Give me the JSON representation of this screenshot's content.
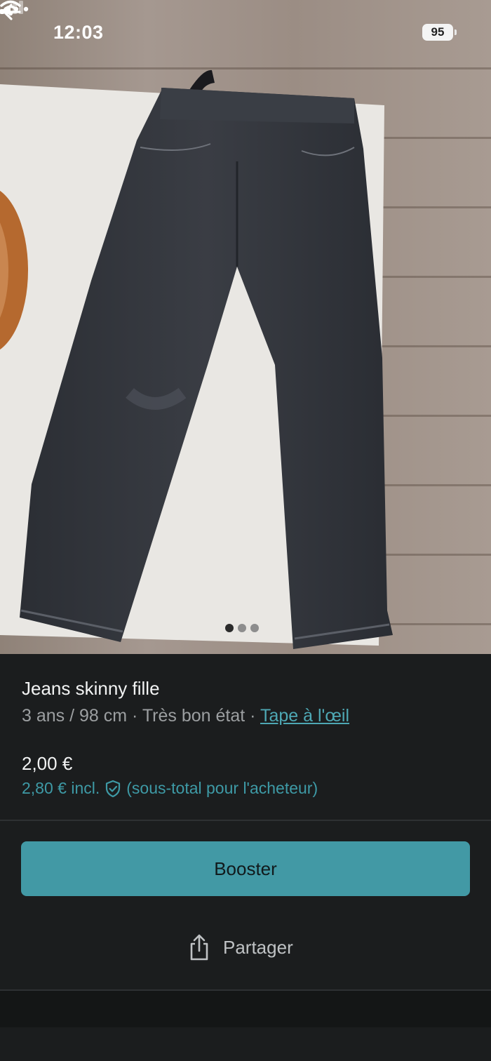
{
  "status_bar": {
    "time": "12:03",
    "battery": "95"
  },
  "photo": {
    "pager_total": 3,
    "pager_active": 0
  },
  "item": {
    "title": "Jeans skinny fille",
    "size": "3 ans / 98 cm",
    "separator": " · ",
    "condition": "Très bon état",
    "brand": "Tape à l'œil",
    "price": "2,00 €",
    "price_incl": "2,80 € incl.",
    "price_note": "(sous-total pour l'acheteur)"
  },
  "actions": {
    "booster_label": "Booster",
    "share_label": "Partager"
  },
  "colors": {
    "accent": "#4299a5",
    "link": "#4ea8b4",
    "background": "#1b1d1e"
  },
  "icons": [
    "back-arrow-icon",
    "more-icon",
    "signal-icon",
    "wifi-icon",
    "battery-icon",
    "shield-check-icon",
    "share-icon"
  ]
}
